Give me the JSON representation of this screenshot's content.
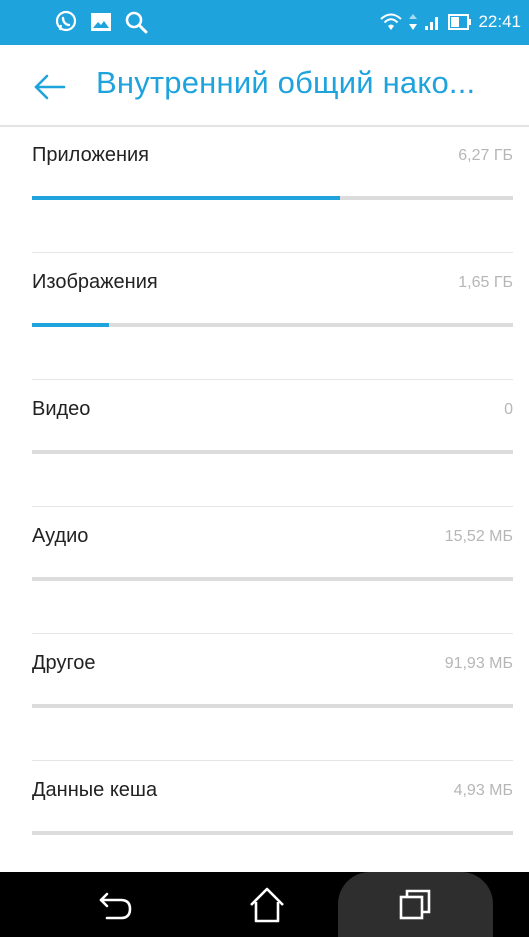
{
  "status_bar": {
    "time": "22:41",
    "left_icons": [
      "viber-icon",
      "gallery-icon",
      "search-icon"
    ],
    "right_icons": [
      "wifi-icon",
      "data-arrows-icon",
      "signal-icon",
      "battery-icon"
    ],
    "color": "#1fa3dd"
  },
  "app_bar": {
    "title": "Внутренний общий нако...",
    "back_icon": "arrow-left-icon",
    "accent_color": "#1fa3dd"
  },
  "storage": {
    "items": [
      {
        "label": "Приложения",
        "size": "6,27 ГБ",
        "fraction": 0.64
      },
      {
        "label": "Изображения",
        "size": "1,65 ГБ",
        "fraction": 0.16
      },
      {
        "label": "Видео",
        "size": "0",
        "fraction": 0
      },
      {
        "label": "Аудио",
        "size": "15,52 МБ",
        "fraction": 0
      },
      {
        "label": "Другое",
        "size": "91,93 МБ",
        "fraction": 0
      },
      {
        "label": "Данные кеша",
        "size": "4,93 МБ",
        "fraction": 0
      }
    ]
  },
  "nav_bar": {
    "buttons": [
      "back-icon",
      "home-icon",
      "recents-icon"
    ]
  }
}
